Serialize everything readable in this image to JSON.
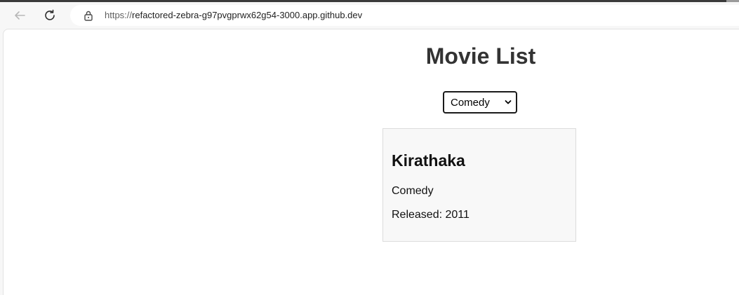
{
  "browser": {
    "url_scheme": "https://",
    "url_host": "refactored-zebra-g97pvgprwx62g54-3000.app.github.dev"
  },
  "page": {
    "title": "Movie List",
    "genre_filter": {
      "selected": "Comedy"
    },
    "movies": [
      {
        "title": "Kirathaka",
        "genre": "Comedy",
        "released": "Released: 2011"
      }
    ]
  },
  "colors": {
    "title_text": "#333333",
    "card_background": "#f8f8f8",
    "card_border": "#dcdcdc"
  }
}
